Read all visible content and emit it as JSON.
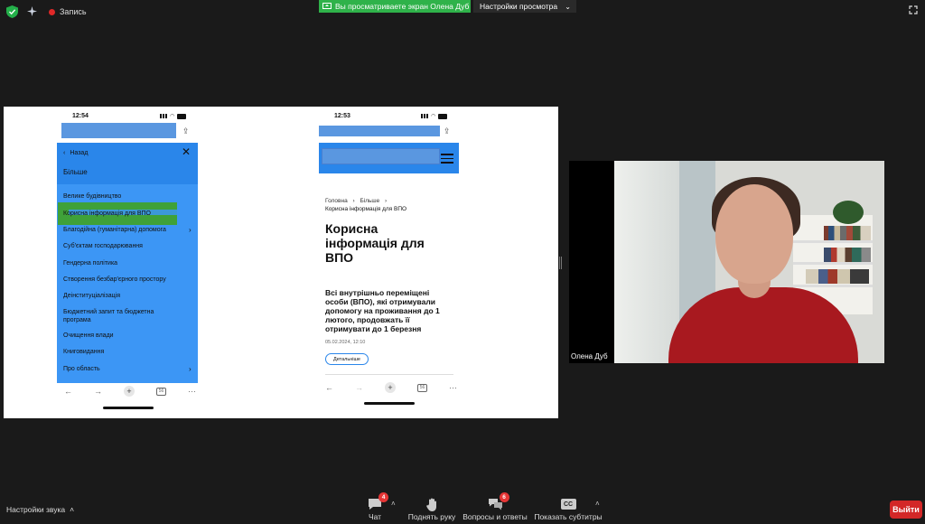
{
  "top_bar": {
    "record_label": "Запись",
    "share_banner_text": "Вы просматриваете экран Олена Дуб",
    "view_settings_label": "Настройки просмотра"
  },
  "shared_screen": {
    "left_phone": {
      "time": "12:54",
      "back_label": "Назад",
      "menu_title": "Більше",
      "menu_items": [
        "Велике будівництво",
        "Корисна інформація для ВПО",
        "Благодійна (гуманітарна) допомога",
        "Суб'єктам господарювання",
        "Гендерна політика",
        "Створення безбар'єрного простору",
        "Деінституціалізація",
        "Бюджетний запит та бюджетна програма",
        "Очищення влади",
        "Книговидання",
        "Про область"
      ],
      "tabs_count": "56"
    },
    "right_phone": {
      "time": "12:53",
      "breadcrumbs": [
        "Головна",
        "Більше"
      ],
      "breadcrumb_current": "Корисна інформація для ВПО",
      "page_title": "Корисна інформація для ВПО",
      "news_title": "Всі внутрішньо переміщені особи (ВПО), які отримували допомогу на проживання до 1 лютого, продовжать її отримувати до 1 березня",
      "news_date": "05.02.2024, 12:10",
      "more_button": "Детальніше",
      "tabs_count": "56"
    }
  },
  "video": {
    "participant_name": "Олена Дуб"
  },
  "bottom_toolbar": {
    "audio_settings_label": "Настройки звука",
    "chat_label": "Чат",
    "chat_badge": "4",
    "raise_hand_label": "Поднять руку",
    "qa_label": "Вопросы и ответы",
    "qa_badge": "6",
    "captions_label": "Показать субтитры",
    "cc_text": "CC",
    "exit_label": "Выйти"
  },
  "colors": {
    "share_banner": "#2fb24a",
    "menu_blue": "#3c96f5",
    "header_blue": "#2a86ea",
    "highlight_green": "#3fa139",
    "exit_red": "#d32727",
    "badge_red": "#e53535",
    "sweater_red": "#a8191f"
  }
}
